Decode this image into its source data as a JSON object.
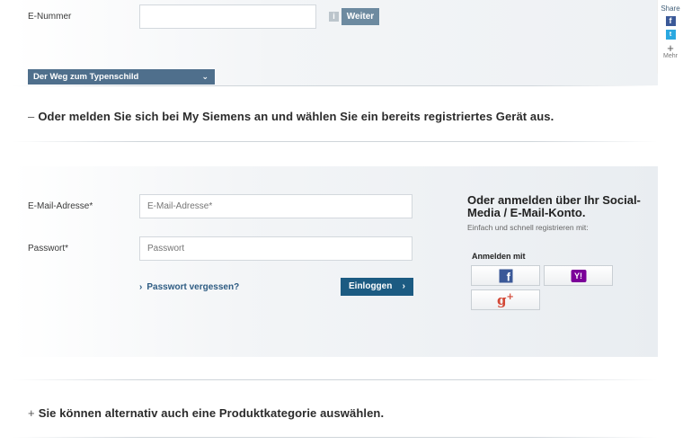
{
  "e_nummer": {
    "label": "E-Nummer",
    "value": "",
    "info_icon": "i",
    "button": "Weiter"
  },
  "dropdown": {
    "label": "Der Weg zum Typenschild",
    "chevron": "⌄"
  },
  "share": {
    "title": "Share",
    "facebook": "f",
    "twitter": "t",
    "more_plus": "+",
    "more": "Mehr"
  },
  "section_login": {
    "toggle": "–",
    "heading": "Oder melden Sie sich bei My Siemens an und wählen Sie ein bereits registriertes Gerät aus."
  },
  "login": {
    "email_label": "E-Mail-Adresse*",
    "email_placeholder": "E-Mail-Adresse*",
    "password_label": "Passwort*",
    "password_placeholder": "Passwort",
    "forgot": "Passwort vergessen?",
    "forgot_arrow": "›",
    "submit": "Einloggen",
    "submit_arrow": "›"
  },
  "social": {
    "title": "Oder anmelden über Ihr Social-Media / E-Mail-Konto.",
    "subtitle": "Einfach und schnell registrieren mit:",
    "anmelden_mit": "Anmelden mit",
    "facebook_glyph": "f",
    "yahoo_glyph": "Y!",
    "google_glyph": "g",
    "google_plus": "+"
  },
  "section_category": {
    "toggle": "+",
    "heading": "Sie können alternativ auch eine Produktkategorie auswählen."
  },
  "colors": {
    "accent_dark": "#1c5b82",
    "accent_mid": "#4f6f8c",
    "button_grey_blue": "#6d8aa0"
  }
}
